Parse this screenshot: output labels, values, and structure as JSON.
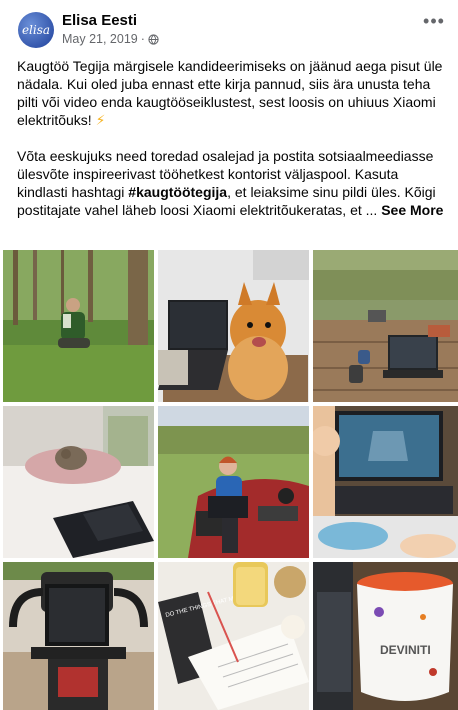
{
  "post": {
    "page_name": "Elisa Eesti",
    "avatar_text": "elisa",
    "date": "May 21, 2019",
    "separator": "·",
    "paragraph_1_a": "Kaugtöö Tegija märgisele kandideerimiseks on jäänud aega pisut üle nädala. Kui oled juba ennast ette kirja pannud, siis ära unusta teha pilti või video enda kaugtööseiklustest, sest loosis on uhiuus Xiaomi elektritõuks!",
    "paragraph_1_emoji": "⚡",
    "paragraph_2_a": "Võta eeskujuks need toredad osalejad ja postita sotsiaalmeediasse ülesvõte inspireerivast tööhetkest kontorist väljaspool. Kasuta kindlasti hashtagi ",
    "hashtag": "#kaugtöötegija",
    "paragraph_2_b": ", et leiaksime sinu pildi üles. Kõigi postitajate vahel läheb loosi Xiaomi elektritõukeratas, et ... ",
    "see_more": "See More",
    "more_options": "•••"
  },
  "photos": {
    "mug_brand": "DEVINITI",
    "notebook_text": "DO THE THINGS THAT MAKE YOU"
  },
  "colors": {
    "text": "#050505",
    "meta": "#65676b",
    "avatar": "#1e3f9a"
  }
}
